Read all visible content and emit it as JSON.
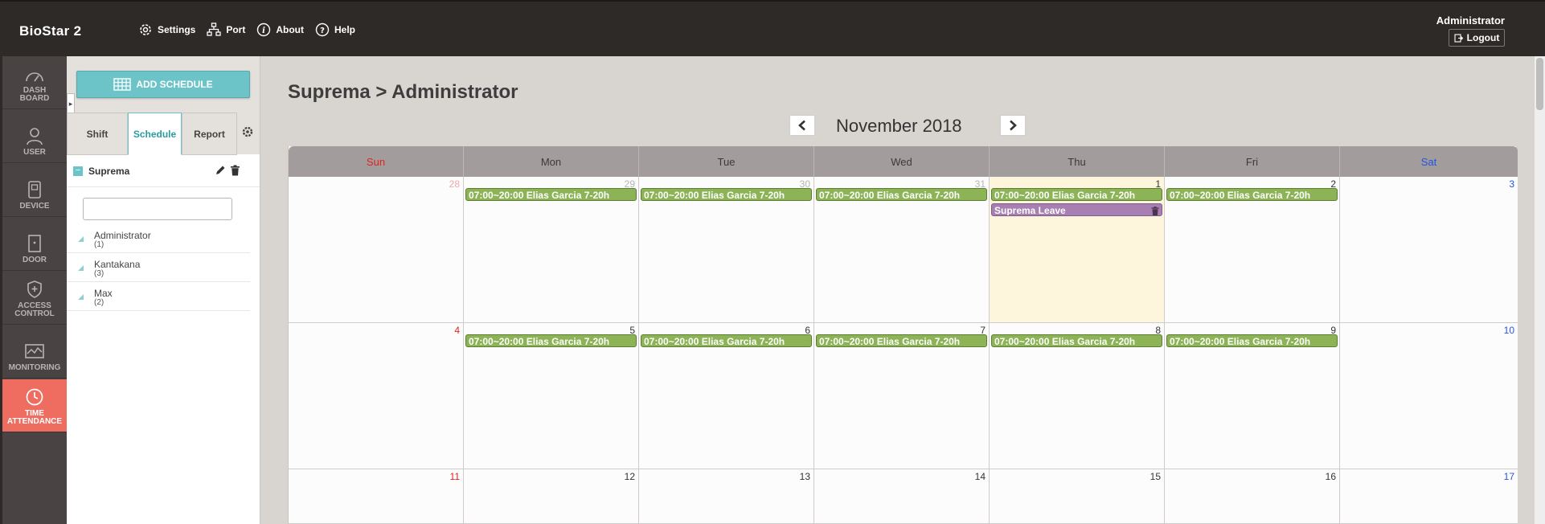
{
  "app": {
    "brand": "BioStar 2"
  },
  "topnav": {
    "items": [
      {
        "label": "Settings",
        "icon": "gear-icon"
      },
      {
        "label": "Port",
        "icon": "network-icon"
      },
      {
        "label": "About",
        "icon": "info-icon"
      },
      {
        "label": "Help",
        "icon": "question-icon"
      }
    ],
    "user": "Administrator",
    "logout": "Logout"
  },
  "leftnav": {
    "items": [
      {
        "label": "DASH BOARD",
        "icon": "dashboard-icon"
      },
      {
        "label": "USER",
        "icon": "user-icon"
      },
      {
        "label": "DEVICE",
        "icon": "device-icon"
      },
      {
        "label": "DOOR",
        "icon": "door-icon"
      },
      {
        "label": "ACCESS CONTROL",
        "icon": "shield-icon"
      },
      {
        "label": "MONITORING",
        "icon": "monitoring-icon"
      },
      {
        "label": "TIME ATTENDANCE",
        "icon": "clock-icon",
        "active": true
      }
    ]
  },
  "sidebar": {
    "add_button": "ADD SCHEDULE",
    "tabs": [
      {
        "label": "Shift"
      },
      {
        "label": "Schedule",
        "active": true
      },
      {
        "label": "Report"
      }
    ],
    "group": "Suprema",
    "search": {
      "value": "",
      "placeholder": ""
    },
    "users": [
      {
        "name": "Administrator",
        "count": "(1)"
      },
      {
        "name": "Kantakana",
        "count": "(3)"
      },
      {
        "name": "Max",
        "count": "(2)"
      }
    ]
  },
  "main": {
    "title": "Suprema > Administrator",
    "month": "November 2018"
  },
  "calendar": {
    "weekdays": [
      "Sun",
      "Mon",
      "Tue",
      "Wed",
      "Thu",
      "Fri",
      "Sat"
    ],
    "weeks": [
      [
        {
          "day": "28",
          "kind": "other-sun",
          "events": []
        },
        {
          "day": "29",
          "kind": "other",
          "events": [
            {
              "type": "shift",
              "label": "07:00~20:00 Elias Garcia 7-20h"
            }
          ]
        },
        {
          "day": "30",
          "kind": "other",
          "events": [
            {
              "type": "shift",
              "label": "07:00~20:00 Elias Garcia 7-20h"
            }
          ]
        },
        {
          "day": "31",
          "kind": "other",
          "events": [
            {
              "type": "shift",
              "label": "07:00~20:00 Elias Garcia 7-20h"
            }
          ]
        },
        {
          "day": "1",
          "kind": "normal",
          "today": true,
          "events": [
            {
              "type": "shift",
              "label": "07:00~20:00 Elias Garcia 7-20h"
            },
            {
              "type": "leave",
              "label": "Suprema Leave"
            }
          ]
        },
        {
          "day": "2",
          "kind": "normal",
          "events": [
            {
              "type": "shift",
              "label": "07:00~20:00 Elias Garcia 7-20h"
            }
          ]
        },
        {
          "day": "3",
          "kind": "sat",
          "events": []
        }
      ],
      [
        {
          "day": "4",
          "kind": "sun",
          "events": []
        },
        {
          "day": "5",
          "kind": "normal",
          "events": [
            {
              "type": "shift",
              "label": "07:00~20:00 Elias Garcia 7-20h"
            }
          ]
        },
        {
          "day": "6",
          "kind": "normal",
          "events": [
            {
              "type": "shift",
              "label": "07:00~20:00 Elias Garcia 7-20h"
            }
          ]
        },
        {
          "day": "7",
          "kind": "normal",
          "events": [
            {
              "type": "shift",
              "label": "07:00~20:00 Elias Garcia 7-20h"
            }
          ]
        },
        {
          "day": "8",
          "kind": "normal",
          "events": [
            {
              "type": "shift",
              "label": "07:00~20:00 Elias Garcia 7-20h"
            }
          ]
        },
        {
          "day": "9",
          "kind": "normal",
          "events": [
            {
              "type": "shift",
              "label": "07:00~20:00 Elias Garcia 7-20h"
            }
          ]
        },
        {
          "day": "10",
          "kind": "sat",
          "events": []
        }
      ],
      [
        {
          "day": "11",
          "kind": "sun",
          "events": []
        },
        {
          "day": "12",
          "kind": "normal",
          "events": []
        },
        {
          "day": "13",
          "kind": "normal",
          "events": []
        },
        {
          "day": "14",
          "kind": "normal",
          "events": []
        },
        {
          "day": "15",
          "kind": "normal",
          "events": []
        },
        {
          "day": "16",
          "kind": "normal",
          "events": []
        },
        {
          "day": "17",
          "kind": "sat",
          "events": []
        }
      ]
    ]
  },
  "colors": {
    "topbar": "#2d2a28",
    "leftnav": "#4a4343",
    "active_nav": "#ef6c61",
    "accent": "#6cc4c8",
    "shift_event": "#8cb356",
    "leave_event": "#a77fb2",
    "today": "#fdf5dc"
  }
}
